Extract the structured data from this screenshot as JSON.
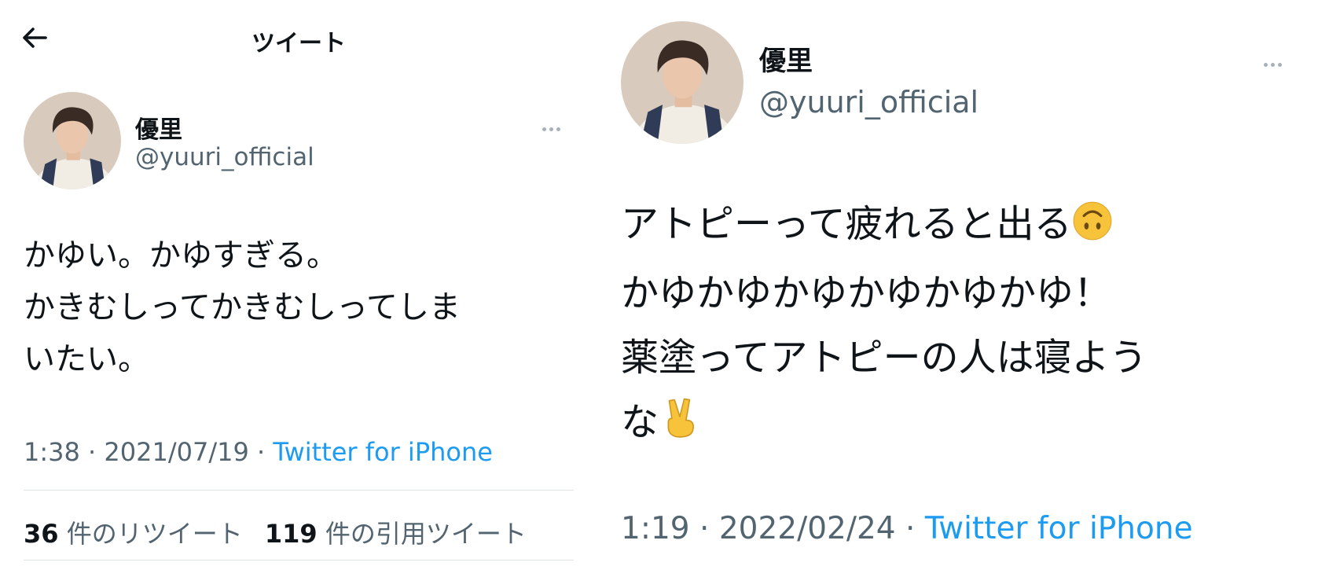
{
  "left_tweet": {
    "header_title": "ツイート",
    "user": {
      "name": "優里",
      "handle": "@yuuri_official"
    },
    "text": "かゆい。かゆすぎる。\nかきむしってかきむしってしま\nいたい。",
    "time": "1:38",
    "date": "2021/07/19",
    "source": "Twitter for iPhone",
    "retweets": {
      "count": "36",
      "label": "件のリツイート"
    },
    "quotes": {
      "count": "119",
      "label": "件の引用ツイート"
    }
  },
  "right_tweet": {
    "user": {
      "name": "優里",
      "handle": "@yuuri_official"
    },
    "text_line1": "アトピーって疲れると出る",
    "text_rest": "かゆかゆかゆかゆかゆかゆ！\n薬塗ってアトピーの人は寝よう\nな",
    "time": "1:19",
    "date": "2022/02/24",
    "source": "Twitter for iPhone"
  },
  "meta_separator": "·",
  "icons": [
    "back-arrow-icon",
    "more-options-icon",
    "upside-down-face-emoji",
    "victory-hand-emoji"
  ],
  "colors": {
    "link": "#1d9bf0",
    "secondary_text": "#536471",
    "text": "#0f1419"
  }
}
